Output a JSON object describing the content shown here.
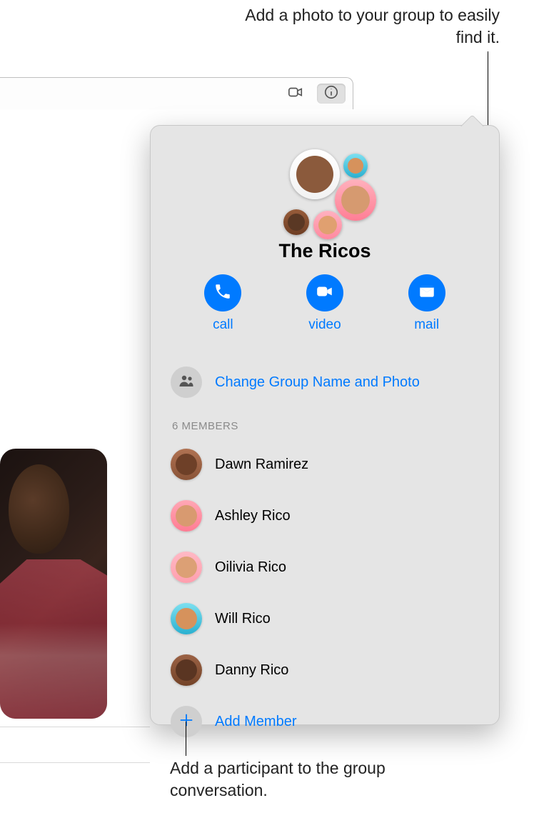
{
  "annotations": {
    "top": "Add a photo to your group to easily find it.",
    "bottom": "Add a participant to the group conversation."
  },
  "toolbar": {
    "camera_icon": "camera-icon",
    "info_icon": "info-icon"
  },
  "group": {
    "name": "The Ricos",
    "members_header": "6 MEMBERS"
  },
  "actions": {
    "call": "call",
    "video": "video",
    "mail": "mail"
  },
  "change_label": "Change Group Name and Photo",
  "members": [
    {
      "name": "Dawn Ramirez"
    },
    {
      "name": "Ashley Rico"
    },
    {
      "name": "Oilivia Rico"
    },
    {
      "name": "Will Rico"
    },
    {
      "name": "Danny Rico"
    }
  ],
  "add_member_label": "Add Member"
}
